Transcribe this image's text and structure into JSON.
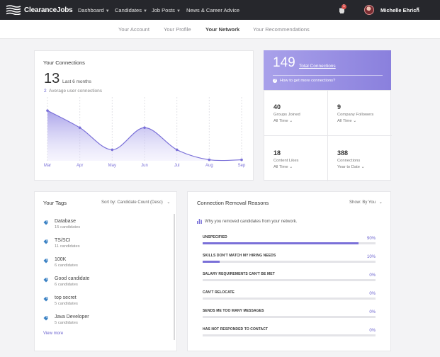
{
  "topnav": {
    "brand": "ClearanceJobs",
    "items": [
      {
        "label": "Dashboard"
      },
      {
        "label": "Candidates"
      },
      {
        "label": "Job Posts"
      },
      {
        "label": "News & Career Advice"
      }
    ],
    "notification_count": "1",
    "user_name": "Michelle Ehrich"
  },
  "subnav": {
    "items": [
      {
        "label": "Your Account"
      },
      {
        "label": "Your Profile"
      },
      {
        "label": "Your Network"
      },
      {
        "label": "Your Recommendations"
      }
    ],
    "active": "Your Network"
  },
  "connections": {
    "title": "Your Connections",
    "count": "13",
    "count_label": "Last 6 months",
    "average_value": "2",
    "average_label": "Average user connections"
  },
  "chart_data": {
    "type": "area",
    "categories": [
      "Mar",
      "Apr",
      "May",
      "Jun",
      "Jul",
      "Aug",
      "Sep"
    ],
    "values": [
      5,
      3.3,
      1.1,
      3.3,
      1.1,
      0.1,
      0.1
    ],
    "ylim": [
      0,
      6
    ],
    "grid": "vertical dashed",
    "accent": "#7a70d8"
  },
  "total": {
    "count": "149",
    "label": "Total Connections",
    "help": "How to get more connections?"
  },
  "stats": [
    {
      "value": "40",
      "label": "Groups Joined",
      "period": "All Time"
    },
    {
      "value": "9",
      "label": "Company Followers",
      "period": "All Time"
    },
    {
      "value": "18",
      "label": "Content Likes",
      "period": "All Time"
    },
    {
      "value": "388",
      "label": "Connections",
      "period": "Year to Date"
    }
  ],
  "tags": {
    "title": "Your Tags",
    "sort_label": "Sort by: Candidate Count (Desc)",
    "view_more": "View more",
    "items": [
      {
        "name": "Database",
        "count": "15 candidates"
      },
      {
        "name": "TS/SCI",
        "count": "11 candidates"
      },
      {
        "name": "100K",
        "count": "6 candidates"
      },
      {
        "name": "Good candidate",
        "count": "6 candidates"
      },
      {
        "name": "top secret",
        "count": "5 candidates"
      },
      {
        "name": "Java Developer",
        "count": "5 candidates"
      }
    ]
  },
  "removal": {
    "title": "Connection Removal Reasons",
    "show_label": "Show: By You",
    "subtitle": "Why you removed candidates from your network.",
    "reasons": [
      {
        "label": "UNSPECIFIED",
        "pct": "90%",
        "value": 90
      },
      {
        "label": "SKILLS DON'T MATCH MY HIRING NEEDS",
        "pct": "10%",
        "value": 10
      },
      {
        "label": "SALARY REQUIREMENTS CAN'T BE MET",
        "pct": "0%",
        "value": 0
      },
      {
        "label": "CAN'T RELOCATE",
        "pct": "0%",
        "value": 0
      },
      {
        "label": "SENDS ME TOO MANY MESSAGES",
        "pct": "0%",
        "value": 0
      },
      {
        "label": "HAS NOT RESPONDED TO CONTACT",
        "pct": "0%",
        "value": 0
      }
    ]
  }
}
